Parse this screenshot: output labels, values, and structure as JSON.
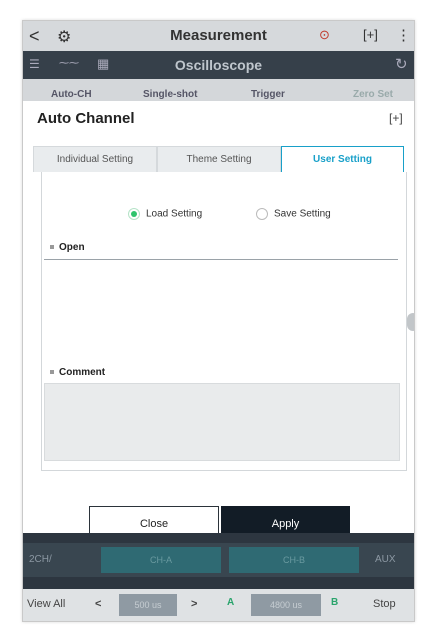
{
  "topbar": {
    "back": "<",
    "title": "Measurement",
    "rec": "⊙",
    "screenshot": "[+]",
    "more": "⋮"
  },
  "scopebar": {
    "title": "Oscilloscope"
  },
  "modebar": {
    "items": [
      "Auto-CH",
      "Single-shot",
      "Trigger",
      "Zero Set"
    ]
  },
  "dialog": {
    "title": "Auto Channel",
    "expand": "[+]",
    "tabs": [
      "Individual Setting",
      "Theme Setting",
      "User Setting"
    ],
    "active_tab": "User Setting",
    "radio_load": "Load Setting",
    "radio_save": "Save Setting",
    "selected_radio": "Load Setting",
    "section_open": "Open",
    "section_comment": "Comment",
    "close_label": "Close",
    "apply_label": "Apply"
  },
  "bottom": {
    "ch_count": "2CH/",
    "ch_a": "CH-A",
    "ch_b": "CH-B",
    "aux": "AUX",
    "view_all": "View All",
    "prev": "<",
    "time_div": "500 us",
    "next": ">",
    "marker_a": "A",
    "marker_time": "4800 us",
    "marker_b": "B",
    "stop": "Stop"
  },
  "colors": {
    "accent": "#18a0c9",
    "radio_on": "#2ec46c",
    "apply_bg": "#121c26"
  }
}
